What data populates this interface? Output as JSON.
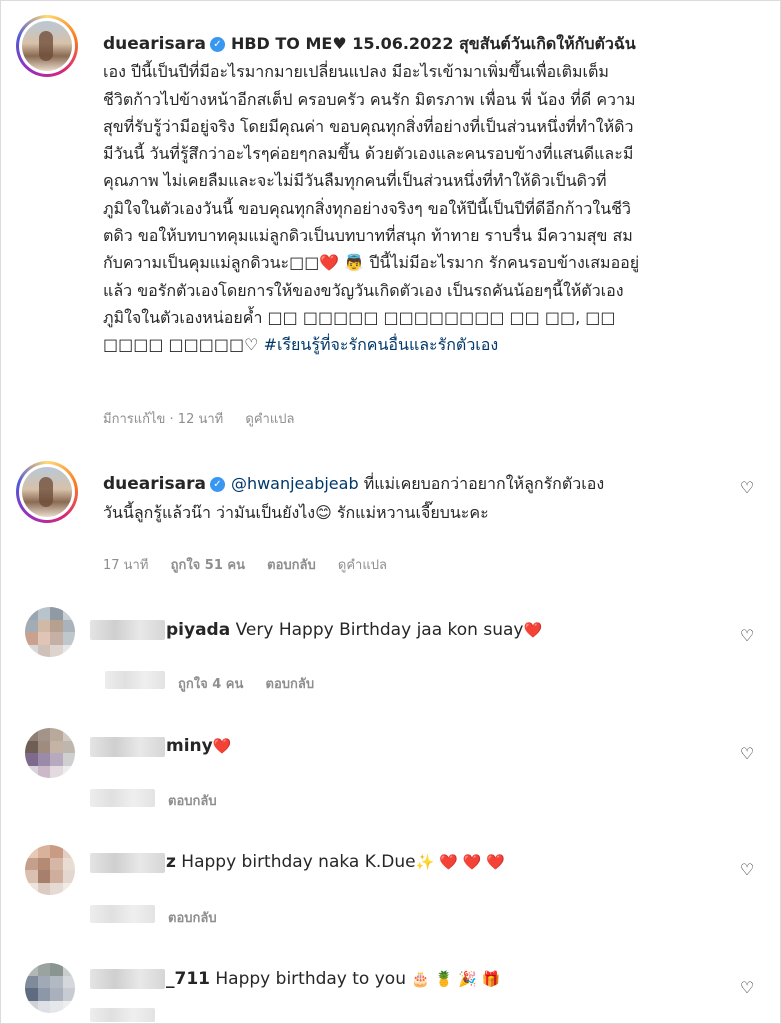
{
  "post": {
    "username": "duearisara",
    "caption_lines": [
      "HBD TO ME♥ 15.06.2022 สุขสันต์วันเกิดให้กับตัวฉัน",
      "เอง ปีนี้เป็นปีที่มีอะไรมากมายเปลี่ยนแปลง มีอะไรเข้ามาเพิ่มขึ้นเพื่อเติมเต็ม",
      "ชีวิตก้าวไปข้างหน้าอีกสเต็ป ครอบครัว คนรัก มิตรภาพ เพื่อน พี่ น้อง ที่ดี ความ",
      "สุขที่รับรู้ว่ามีอยู่จริง โดยมีคุณค่า ขอบคุณทุกสิ่งที่อย่างที่เป็นส่วนหนึ่งที่ทำให้ดิว",
      "มีวันนี้ วันที่รู้สึกว่าอะไรๆค่อยๆกลมขึ้น ด้วยตัวเองและคนรอบข้างที่แสนดีและมี",
      "คุณภาพ ไม่เคยลืมและจะไม่มีวันลืมทุกคนที่เป็นส่วนหนึ่งที่ทำให้ดิวเป็นดิวที่",
      "ภูมิใจในตัวเองวันนี้ ขอบคุณทุกสิ่งทุกอย่างจริงๆ ขอให้ปีนี้เป็นปีที่ดีอีกก้าวในชีวิ",
      "ตดิว ขอให้บทบาทคุมแม่ลูกดิวเป็นบทบาทที่สนุก ท้าทาย ราบรื่น มีความสุข สม",
      "กับความเป็นคุมแม่ลูกดิวนะ□□❤️ 👼 ปีนี้ไม่มีอะไรมาก รักคนรอบข้างเสมออยู่",
      "แล้ว ขอรักตัวเองโดยการให้ของขวัญวันเกิดตัวเอง เป็นรถคันน้อยๆนี้ให้ตัวเอง",
      "ภูมิใจในตัวเองหน่อยค้ำ □□ □□□□□ □□□□□□□□ □□ □□, □□",
      "□□□□ □□□□□♡"
    ],
    "hashtag": "#เรียนรู้ที่จะรักคนอื่นและรักตัวเอง",
    "meta": {
      "edited": "มีการแก้ไข · 12 นาที",
      "translate": "ดูคำแปล"
    }
  },
  "reply": {
    "username": "duearisara",
    "mention": "@hwanjeabjeab",
    "text_line1": " ที่แม่เคยบอกว่าอยากให้ลูกรักตัวเอง",
    "text_line2": "วันนี้ลูกรู้แล้วน๊า ว่ามันเป็นยังไง😊 รักแม่หวานเจี๊ยบนะคะ",
    "time": "17 นาที",
    "likes": "ถูกใจ 51 คน",
    "reply_label": "ตอบกลับ",
    "translate": "ดูคำแปล"
  },
  "comments": [
    {
      "handle": "piyada",
      "text": " Very Happy Birthday jaa kon suay",
      "emoji": "❤️",
      "likes": "ถูกใจ 4 คน",
      "reply_label": "ตอบกลับ"
    },
    {
      "handle": "miny",
      "text": "",
      "emoji": "❤️",
      "likes": "",
      "reply_label": "ตอบกลับ"
    },
    {
      "handle": "z",
      "text": " Happy birthday naka K.Due",
      "emoji": "✨ ❤️ ❤️ ❤️",
      "likes": "",
      "reply_label": "ตอบกลับ"
    },
    {
      "handle": "_711",
      "text": " Happy birthday to you",
      "emoji": "🎂 🍍 🎉 🎁",
      "likes": "",
      "reply_label": ""
    }
  ],
  "icons": {
    "verified": "verified-badge-icon",
    "heart": "heart-outline-icon"
  },
  "colors": {
    "link": "#00376b",
    "verified": "#3897f0",
    "meta": "#8e8e8e"
  }
}
